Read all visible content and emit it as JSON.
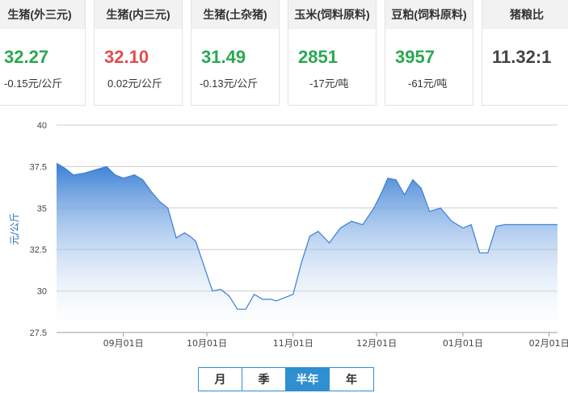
{
  "cards": [
    {
      "title": "生猪(外三元)",
      "price": "32.27",
      "change": "-0.15元/公斤",
      "trend": "down"
    },
    {
      "title": "生猪(内三元)",
      "price": "32.10",
      "change": "0.02元/公斤",
      "trend": "up"
    },
    {
      "title": "生猪(土杂猪)",
      "price": "31.49",
      "change": "-0.13元/公斤",
      "trend": "down"
    },
    {
      "title": "玉米(饲料原料)",
      "price": "2851",
      "change": "-17元/吨",
      "trend": "down"
    },
    {
      "title": "豆粕(饲料原料)",
      "price": "3957",
      "change": "-61元/吨",
      "trend": "down"
    },
    {
      "title": "猪粮比",
      "price": "11.32:1",
      "change": "",
      "trend": "neutral"
    }
  ],
  "tabs": {
    "month": "月",
    "season": "季",
    "half_year": "半年",
    "year": "年",
    "active": "half_year"
  },
  "colors": {
    "up": "#e14d4d",
    "down": "#2aa84f",
    "line": "#3a7fd5",
    "fill_top": "#3a7fd5",
    "fill_bottom": "#ffffff",
    "grid": "#cccccc"
  },
  "chart_data": {
    "type": "area",
    "ylabel": "元/公斤",
    "ylim": [
      27.5,
      40
    ],
    "yticks": [
      "27.5",
      "30",
      "32.5",
      "35",
      "37.5",
      "40"
    ],
    "grid": true,
    "x_ticks": [
      "09月01日",
      "10月01日",
      "11月01日",
      "12月01日",
      "01月01日",
      "02月01日"
    ],
    "x_start": "2020-08-08",
    "x_end": "2021-02-04",
    "series": [
      {
        "dates": [
          "2020-08-08",
          "2020-08-11",
          "2020-08-14",
          "2020-08-18",
          "2020-08-22",
          "2020-08-26",
          "2020-08-29",
          "2020-09-01",
          "2020-09-05",
          "2020-09-08",
          "2020-09-11",
          "2020-09-14",
          "2020-09-17",
          "2020-09-20",
          "2020-09-23",
          "2020-09-25",
          "2020-09-27",
          "2020-09-30",
          "2020-10-03",
          "2020-10-06",
          "2020-10-09",
          "2020-10-12",
          "2020-10-15",
          "2020-10-18",
          "2020-10-21",
          "2020-10-24",
          "2020-10-26",
          "2020-10-29",
          "2020-11-01",
          "2020-11-04",
          "2020-11-07",
          "2020-11-10",
          "2020-11-14",
          "2020-11-18",
          "2020-11-22",
          "2020-11-26",
          "2020-11-30",
          "2020-12-03",
          "2020-12-05",
          "2020-12-08",
          "2020-12-11",
          "2020-12-14",
          "2020-12-17",
          "2020-12-20",
          "2020-12-24",
          "2020-12-28",
          "2021-01-01",
          "2021-01-04",
          "2021-01-07",
          "2021-01-10",
          "2021-01-13",
          "2021-01-16",
          "2021-01-19",
          "2021-01-22",
          "2021-01-25",
          "2021-01-27",
          "2021-01-30",
          "2021-02-02",
          "2021-02-04"
        ],
        "values": [
          37.7,
          37.4,
          37.0,
          37.1,
          37.3,
          37.5,
          37.0,
          36.8,
          37.0,
          36.7,
          36.0,
          35.4,
          35.0,
          33.2,
          33.5,
          33.3,
          33.0,
          31.5,
          30.0,
          30.1,
          29.7,
          28.9,
          28.9,
          29.8,
          29.5,
          29.5,
          29.4,
          29.6,
          29.8,
          31.7,
          33.3,
          33.6,
          32.9,
          33.8,
          34.2,
          34.0,
          35.0,
          36.0,
          36.8,
          36.7,
          35.8,
          36.7,
          36.2,
          34.8,
          35.0,
          34.2,
          33.8,
          34.0,
          32.3,
          32.3,
          33.9,
          34.0,
          34.0,
          34.0,
          34.0,
          34.0,
          34.0,
          34.0,
          34.0
        ]
      }
    ]
  }
}
